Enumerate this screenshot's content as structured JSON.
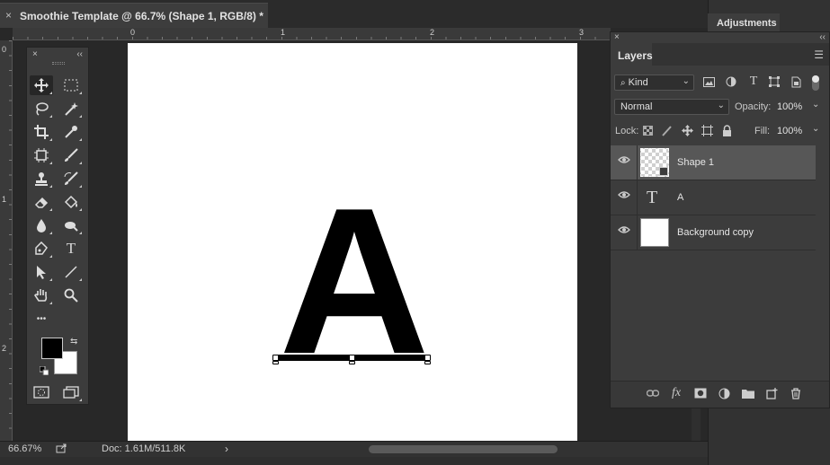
{
  "document": {
    "tab_title": "Smoothie Template @ 66.7% (Shape 1, RGB/8) *",
    "close": "×"
  },
  "ruler": {
    "top_labels": [
      "0",
      "1",
      "2",
      "3"
    ],
    "left_labels": [
      "0",
      "1",
      "2"
    ]
  },
  "canvas": {
    "letter": "A"
  },
  "tools_panel": {
    "collapse": "‹‹",
    "close": "×",
    "tools": [
      "move",
      "marquee",
      "lasso",
      "magic-wand",
      "crop",
      "eyedropper",
      "frame",
      "brush",
      "stamp",
      "history-brush",
      "eraser",
      "paint-bucket",
      "blur",
      "smudge",
      "pen",
      "type",
      "path-select",
      "line",
      "hand",
      "zoom",
      "more"
    ],
    "type_tool_glyph": "T",
    "more_glyph": "•••"
  },
  "status": {
    "zoom": "66.67%",
    "doc": "Doc: 1.61M/511.8K",
    "arrow": "›"
  },
  "adjustments": {
    "tab": "Adjustments"
  },
  "layers_panel": {
    "tab": "Layers",
    "close": "×",
    "collapse": "‹‹",
    "kind_label": "Kind",
    "blend_mode": "Normal",
    "opacity_label": "Opacity:",
    "opacity_value": "100%",
    "lock_label": "Lock:",
    "fill_label": "Fill:",
    "fill_value": "100%",
    "layers": [
      {
        "name": "Shape 1",
        "type": "shape",
        "selected": true
      },
      {
        "name": "A",
        "type": "text",
        "selected": false
      },
      {
        "name": "Background copy",
        "type": "pixel",
        "selected": false
      }
    ],
    "text_glyph": "T",
    "footer_fx": "fx"
  },
  "colors": {
    "foreground": "#000000",
    "background": "#ffffff",
    "selected_layer": "#575757"
  }
}
